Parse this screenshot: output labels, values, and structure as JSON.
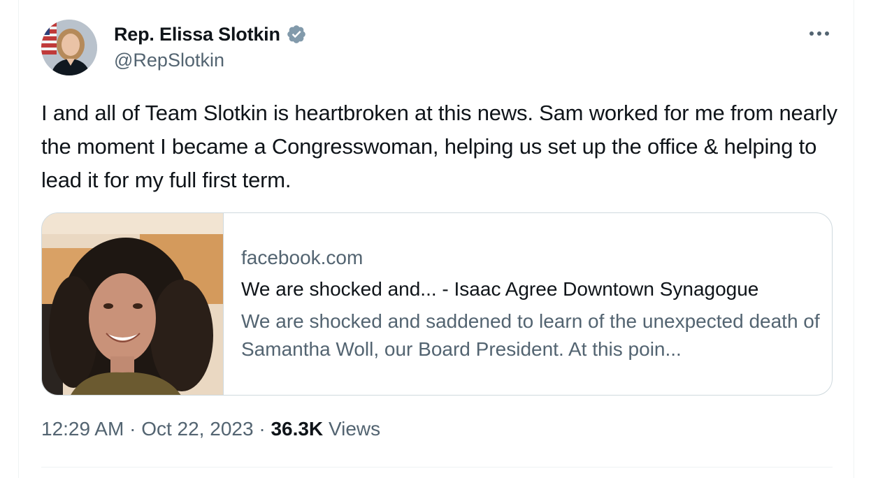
{
  "author": {
    "display_name": "Rep. Elissa Slotkin",
    "handle": "@RepSlotkin",
    "verified_badge_icon": "verified-badge-gray"
  },
  "tweet": {
    "text": "I and all of Team Slotkin is heartbroken at this news. Sam worked for me from nearly the moment I became a Congresswoman, helping us set up the office & helping to lead it for my full first term."
  },
  "link_card": {
    "domain": "facebook.com",
    "title": "We are shocked and... - Isaac Agree Downtown Synagogue",
    "description": "We are shocked and saddened to learn of the unexpected death of Samantha Woll, our Board President. At this poin..."
  },
  "meta": {
    "time": "12:29 AM",
    "separator": "·",
    "date": "Oct 22, 2023",
    "views_count": "36.3K",
    "views_label": "Views"
  },
  "colors": {
    "text_primary": "#0f1419",
    "text_secondary": "#536471",
    "border": "#cfd9de",
    "badge": "#829aab"
  }
}
